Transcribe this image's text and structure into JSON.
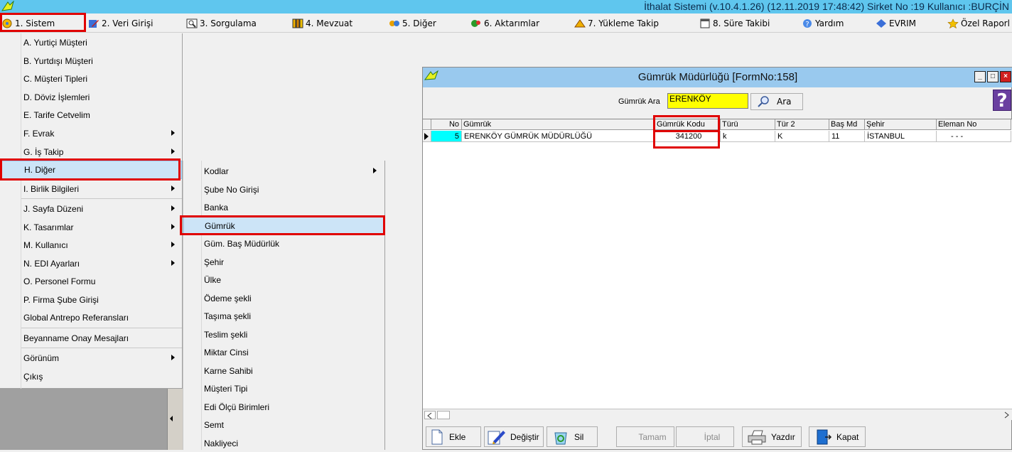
{
  "titlebar": {
    "text": "İthalat Sistemi (v.10.4.1.26) (12.11.2019 17:48:42) Sirket No :19 Kullanıcı :BURÇİN"
  },
  "menubar": {
    "items": [
      "1. Sistem",
      "2. Veri Girişi",
      "3. Sorgulama",
      "4. Mevzuat",
      "5. Diğer",
      "6. Aktarımlar",
      "7. Yükleme Takip",
      "8. Süre Takibi",
      "Yardım",
      "EVRIM",
      "Özel Raporl"
    ]
  },
  "sistem_menu": {
    "items": [
      "A. Yurtiçi Müşteri",
      "B. Yurtdışı Müşteri",
      "C. Müşteri Tipleri",
      "D. Döviz İşlemleri",
      "E. Tarife Cetvelim",
      "F. Evrak",
      "G. İş Takip",
      "H. Diğer",
      "I. Birlik Bilgileri",
      "J. Sayfa Düzeni",
      "K. Tasarımlar",
      "M. Kullanıcı",
      "N. EDI Ayarları",
      "O. Personel Formu",
      "P. Firma Şube Girişi",
      "Global Antrepo Referansları",
      "Beyanname Onay Mesajları",
      "Görünüm",
      "Çıkış"
    ]
  },
  "diger_menu": {
    "items": [
      "Kodlar",
      "Şube No Girişi",
      "Banka",
      "Gümrük",
      "Güm. Baş Müdürlük",
      "Şehir",
      "Ülke",
      "Ödeme şekli",
      "Taşıma şekli",
      "Teslim şekli",
      "Miktar Cinsi",
      "Karne Sahibi",
      "Müşteri Tipi",
      "Edi Ölçü Birimleri",
      "Semt",
      "Nakliyeci"
    ]
  },
  "form": {
    "title": "Gümrük Müdürlüğü [FormNo:158]",
    "search_label": "Gümrük Ara",
    "search_value": "ERENKÖY",
    "search_button": "Ara",
    "help": "?",
    "columns": [
      "No",
      "Gümrük",
      "Gümrük Kodu",
      "Türü",
      "Tür 2",
      "Baş Md",
      "Şehir",
      "Eleman No"
    ],
    "rows": [
      [
        "5",
        "ERENKÖY GÜMRÜK MÜDÜRLÜĞÜ",
        "341200",
        "k",
        "K",
        "11",
        "İSTANBUL",
        "- - -"
      ]
    ],
    "buttons": [
      "Ekle",
      "Değiştir",
      "Sil",
      "Tamam",
      "İptal",
      "Yazdır",
      "Kapat"
    ]
  },
  "colors": {
    "highlight": "#e00000",
    "search_bg": "#ffff00",
    "title_bg": "#5fc6ee",
    "row_indicator": "#00ffff"
  }
}
